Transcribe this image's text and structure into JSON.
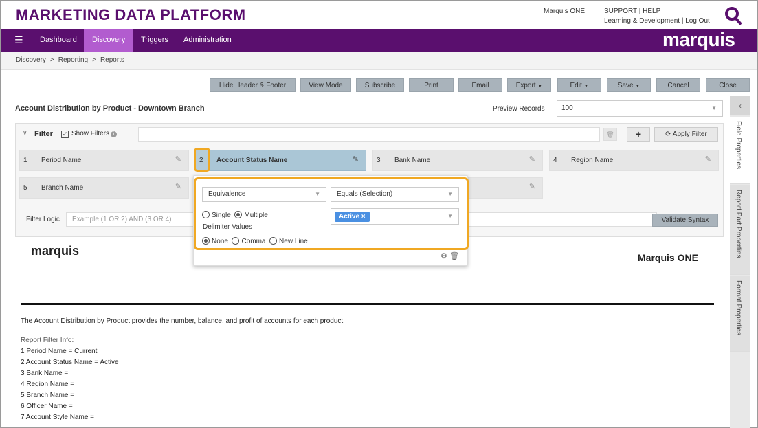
{
  "header": {
    "title": "MARKETING DATA PLATFORM",
    "user_name": "Marquis ONE",
    "support": "SUPPORT | HELP",
    "learning": "Learning & Development | Log Out"
  },
  "nav": {
    "items": [
      "Dashboard",
      "Discovery",
      "Triggers",
      "Administration"
    ],
    "active": "Discovery",
    "logo": "marquis",
    "menu_icon": "hamburger-icon"
  },
  "breadcrumb": [
    "Discovery",
    "Reporting",
    "Reports"
  ],
  "breadcrumb_sep": ">",
  "toolbar": {
    "hide_header_footer": "Hide Header & Footer",
    "view_mode": "View Mode",
    "subscribe": "Subscribe",
    "print": "Print",
    "email": "Email",
    "export": "Export",
    "edit": "Edit",
    "save": "Save",
    "cancel": "Cancel",
    "close": "Close"
  },
  "report": {
    "title": "Account Distribution by Product - Downtown Branch",
    "preview_label": "Preview Records",
    "preview_value": "100"
  },
  "filter": {
    "label": "Filter",
    "show_filters": "Show Filters",
    "apply": "Apply Filter",
    "items": [
      {
        "num": "1",
        "name": "Period Name"
      },
      {
        "num": "2",
        "name": "Account Status Name"
      },
      {
        "num": "3",
        "name": "Bank Name"
      },
      {
        "num": "4",
        "name": "Region Name"
      },
      {
        "num": "5",
        "name": "Branch Name"
      }
    ],
    "logic_label": "Filter Logic",
    "logic_placeholder": "Example (1 OR 2) AND (3 OR 4)",
    "validate": "Validate Syntax"
  },
  "popup": {
    "operator_type": "Equivalence",
    "operator": "Equals (Selection)",
    "single": "Single",
    "multiple": "Multiple",
    "selection_mode": "Multiple",
    "delimiter_label": "Delimiter Values",
    "delim_none": "None",
    "delim_comma": "Comma",
    "delim_newline": "New Line",
    "delimiter_selected": "None",
    "tag": "Active"
  },
  "preview": {
    "logo": "marquis",
    "org": "Marquis ONE",
    "description": "The Account Distribution by Product provides the number, balance, and profit of accounts for each product",
    "filter_info_label": "Report Filter Info:",
    "filter_info": [
      "1 Period Name = Current",
      "2 Account Status Name = Active",
      "3 Bank Name =",
      "4 Region Name =",
      "5 Branch Name =",
      "6 Officer Name =",
      "7 Account Style Name ="
    ]
  },
  "side_panel": {
    "tabs": [
      "Field Properties",
      "Report Part Properties",
      "Format Properties"
    ]
  },
  "colors": {
    "brand_purple": "#5a0f6e",
    "nav_active": "#b25ccf",
    "highlight_orange": "#f0a823",
    "active_filter": "#aac6d6",
    "tag_blue": "#4a90e2"
  }
}
